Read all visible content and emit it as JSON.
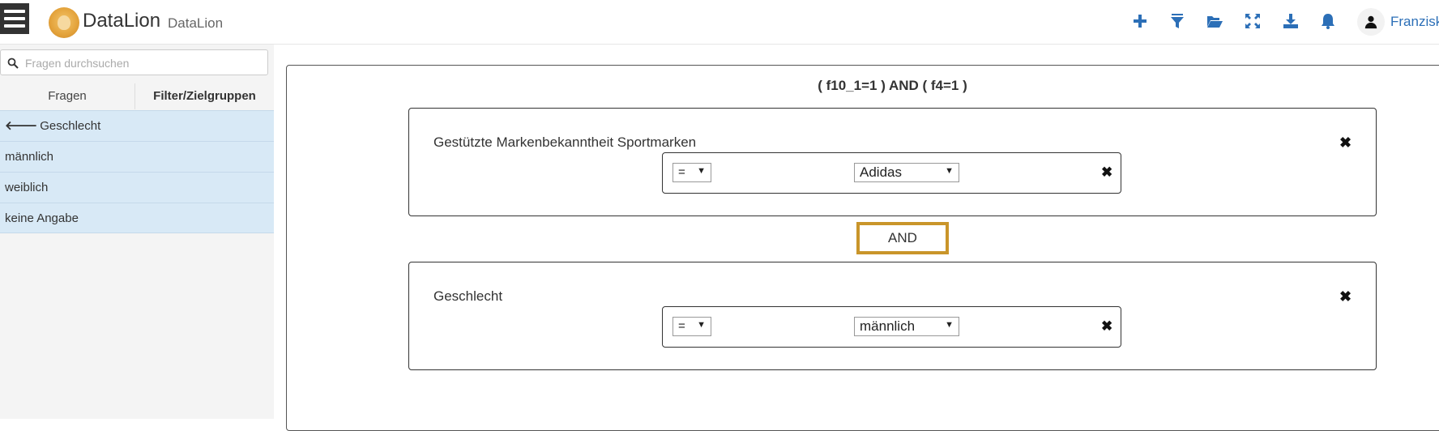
{
  "header": {
    "brand": "DataLion",
    "brand_sub": "DataLion",
    "user_name": "Franzisk",
    "icons": [
      "plus-icon",
      "filter-icon",
      "folder-open-icon",
      "expand-icon",
      "download-icon",
      "bell-icon",
      "user-icon"
    ]
  },
  "sidebar": {
    "search_placeholder": "Fragen durchsuchen",
    "tabs": [
      "Fragen",
      "Filter/Zielgruppen"
    ],
    "items": [
      {
        "label": "Geschlecht",
        "icon": "arrow-left-icon"
      },
      {
        "label": "männlich"
      },
      {
        "label": "weiblich"
      },
      {
        "label": "keine Angabe"
      }
    ]
  },
  "main": {
    "expression": "( f10_1=1 ) AND ( f4=1 )",
    "conditions": [
      {
        "title": "Gestützte Markenbekanntheit Sportmarken",
        "operator": "=",
        "value": "Adidas"
      },
      {
        "title": "Geschlecht",
        "operator": "=",
        "value": "männlich"
      }
    ],
    "connector": "AND"
  },
  "colors": {
    "accent_blue": "#2c6fb7",
    "list_bg": "#d8e9f6",
    "and_border": "#c9952a"
  }
}
